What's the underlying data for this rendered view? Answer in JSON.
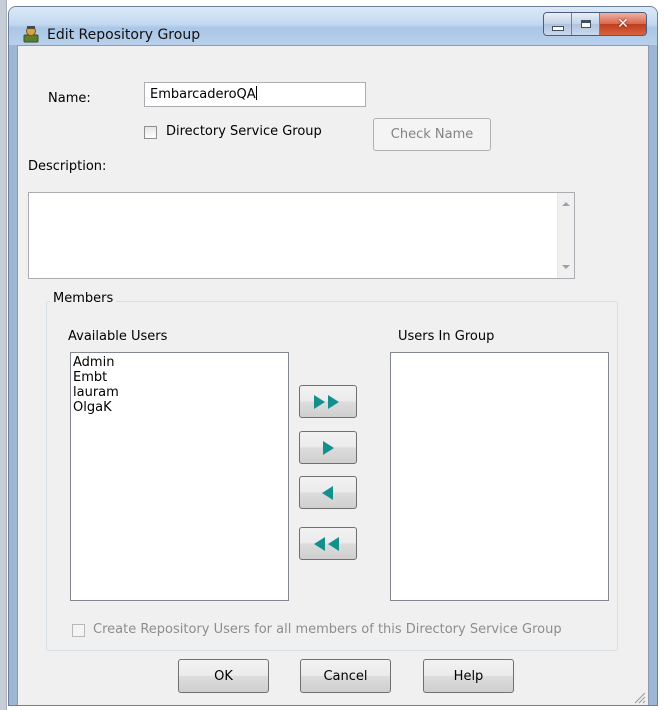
{
  "window": {
    "title": "Edit Repository Group"
  },
  "form": {
    "name_label": "Name:",
    "name_value": "EmbarcaderoQA",
    "directory_checkbox_label": "Directory Service Group",
    "check_name_button": "Check Name",
    "description_label": "Description:",
    "description_value": ""
  },
  "members": {
    "group_label": "Members",
    "available_label": "Available Users",
    "in_group_label": "Users In Group",
    "available_users": [
      "Admin",
      "Embt",
      "lauram",
      "OlgaK"
    ],
    "users_in_group": []
  },
  "create_users_checkbox_label": "Create Repository Users for all members of this Directory Service Group",
  "buttons": {
    "ok": "OK",
    "cancel": "Cancel",
    "help": "Help"
  },
  "colors": {
    "arrow_teal": "#14908c",
    "titlebar": "#b9d1ea",
    "dialog_bg": "#f0f0f0"
  },
  "icons": {
    "title_icon": "repository-group-icon",
    "move_all_right": "double-chevron-right-icon",
    "move_right": "chevron-right-icon",
    "move_left": "chevron-left-icon",
    "move_all_left": "double-chevron-left-icon"
  }
}
